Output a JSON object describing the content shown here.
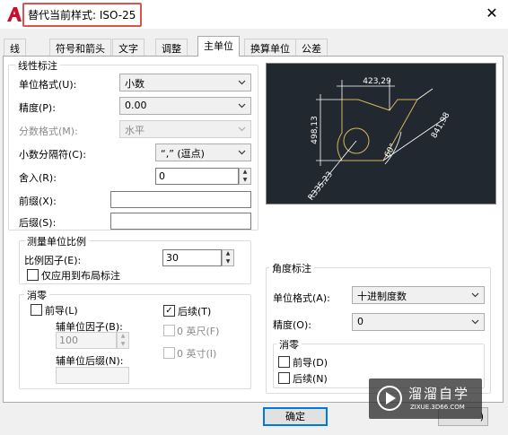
{
  "window": {
    "title": "替代当前样式: ISO-25",
    "close_glyph": "✕",
    "accent_color": "#d9534f"
  },
  "tabs": [
    {
      "label": "线"
    },
    {
      "label": "符号和箭头"
    },
    {
      "label": "文字"
    },
    {
      "label": "调整"
    },
    {
      "label": "主单位"
    },
    {
      "label": "换算单位"
    },
    {
      "label": "公差"
    }
  ],
  "linear": {
    "group_label": "线性标注",
    "unit_format_label": "单位格式(U):",
    "unit_format_value": "小数",
    "precision_label": "精度(P):",
    "precision_value": "0.00",
    "fraction_label": "分数格式(M):",
    "fraction_value": "水平",
    "decimal_sep_label": "小数分隔符(C):",
    "decimal_sep_value": "“,” (逗点)",
    "round_label": "舍入(R):",
    "round_value": "0",
    "prefix_label": "前缀(X):",
    "prefix_value": "",
    "suffix_label": "后缀(S):",
    "suffix_value": ""
  },
  "scale": {
    "group_label": "测量单位比例",
    "factor_label": "比例因子(E):",
    "factor_value": "30",
    "layout_only_label": "仅应用到布局标注"
  },
  "zero_suppress": {
    "group_label": "消零",
    "leading_label": "前导(L)",
    "sub_factor_label": "辅单位因子(B):",
    "sub_factor_value": "100",
    "sub_suffix_label": "辅单位后缀(N):",
    "sub_suffix_value": "",
    "trailing_label": "后续(T)",
    "trailing_check": "✓",
    "feet_label": "0 英尺(F)",
    "inches_label": "0 英寸(I)"
  },
  "angular": {
    "group_label": "角度标注",
    "unit_format_label": "单位格式(A):",
    "unit_format_value": "十进制度数",
    "precision_label": "精度(O):",
    "precision_value": "0",
    "zero_group_label": "消零",
    "leading_label": "前导(D)",
    "trailing_label": "后续(N)"
  },
  "preview": {
    "dim_top": "423,29",
    "dim_left": "498,13",
    "dim_right": "841,98",
    "dim_angle": "60°",
    "dim_radius": "R335,23",
    "line_color": "#d9b65a",
    "dim_color": "#ffffff"
  },
  "footer": {
    "ok_label": "确定",
    "right_label": ")"
  },
  "watermark": {
    "title": "溜溜自学",
    "url": "ZIXUE.3D66.COM"
  }
}
